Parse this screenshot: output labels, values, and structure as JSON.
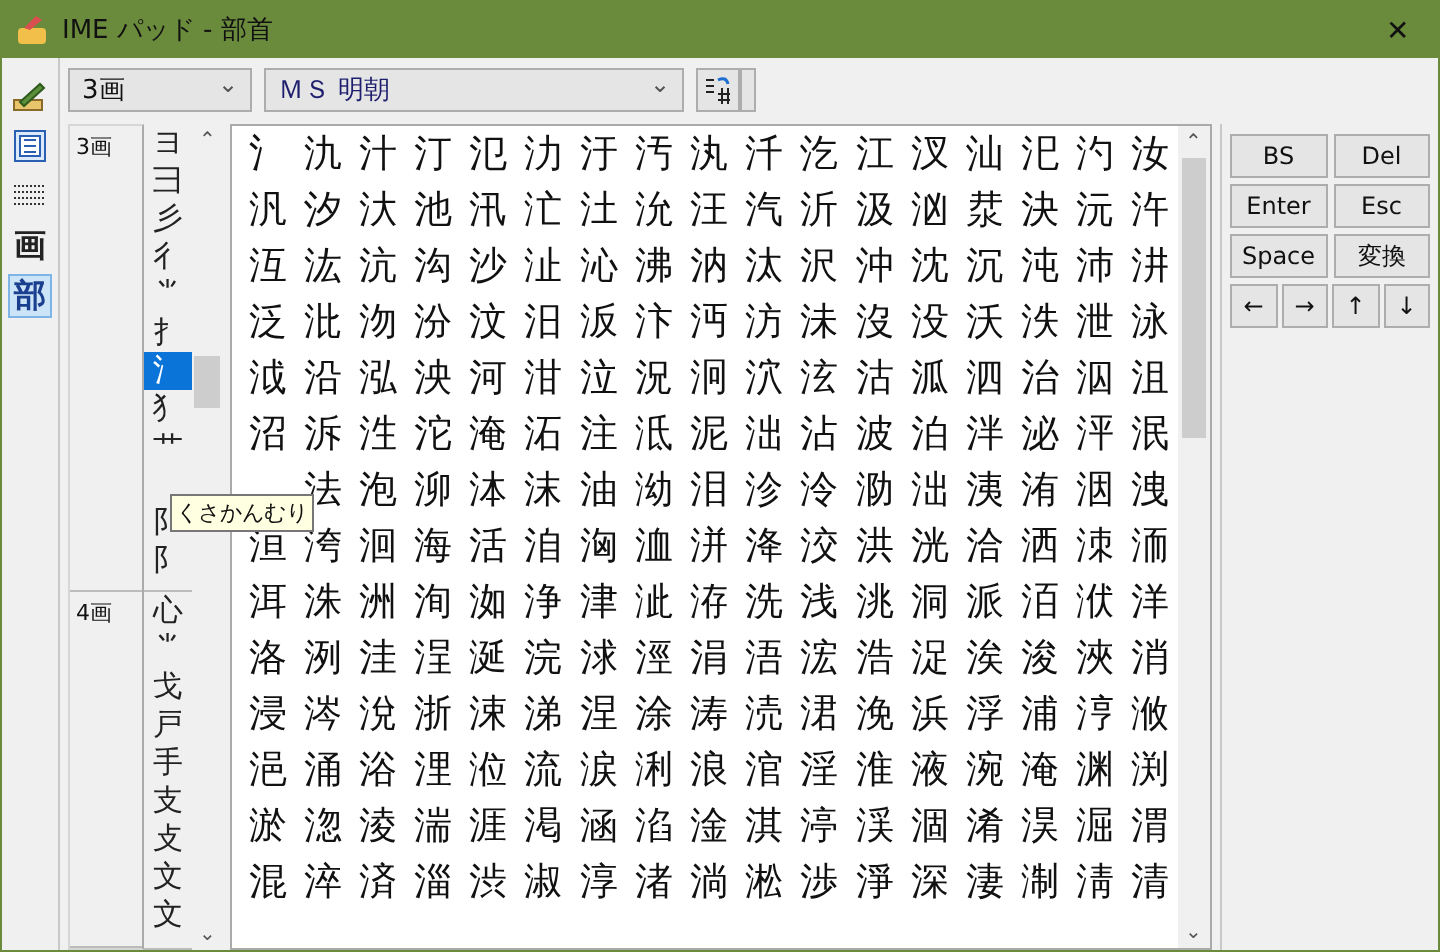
{
  "window": {
    "title": "IME パッド - 部首",
    "close": "✕"
  },
  "tools": [
    {
      "kind": "pen",
      "selected": false
    },
    {
      "kind": "grid",
      "selected": false
    },
    {
      "kind": "keys",
      "selected": false
    },
    {
      "kind": "text",
      "label": "画",
      "selected": false
    },
    {
      "kind": "text",
      "label": "部",
      "selected": true
    }
  ],
  "stroke_dropdown": {
    "value": "3画",
    "caret": "⌄"
  },
  "font_dropdown": {
    "value": "ＭＳ 明朝",
    "caret": "⌄"
  },
  "radical_groups": [
    {
      "label": "3画",
      "items": [
        {
          "char": "ヨ",
          "selected": false
        },
        {
          "char": "彐",
          "selected": false
        },
        {
          "char": "彡",
          "selected": false
        },
        {
          "char": "彳",
          "selected": false
        },
        {
          "char": "⺌",
          "selected": false
        },
        {
          "char": "扌",
          "selected": false
        },
        {
          "char": "氵",
          "selected": true
        },
        {
          "char": "犭",
          "selected": false
        },
        {
          "char": "艹",
          "selected": false
        },
        {
          "selected": false
        },
        {
          "char": "阝",
          "selected": false
        },
        {
          "char": "阝",
          "selected": false
        }
      ]
    },
    {
      "label": "4画",
      "items": [
        {
          "char": "心",
          "selected": false
        },
        {
          "char": "⺌",
          "selected": false
        },
        {
          "char": "戈",
          "selected": false
        },
        {
          "char": "戸",
          "selected": false
        },
        {
          "char": "手",
          "selected": false
        },
        {
          "char": "支",
          "selected": false
        },
        {
          "char": "攴",
          "selected": false
        },
        {
          "char": "文",
          "selected": false
        },
        {
          "char": "文",
          "selected": false
        }
      ]
    }
  ],
  "scroll_up": "⌃",
  "scroll_down": "⌄",
  "tooltip": "くさかんむり",
  "kanji_rows": [
    "氵氿汁汀氾氻汙汚汍汘汔江汊汕汜汋汝",
    "汎汐汏池汛汒汢沇汪汽沂汲汹汬決沅汻",
    "沍汯沆沟沙沚沁沸汭汰沢沖沈沉沌沛汫",
    "泛沘沕汾汶汨汳汴沔汸沬沒没沃泆泄泳",
    "泧沿泓泱河泔泣況泂泬泫沽泒泗治泅沮",
    "沼泝泩沱淹沰注泜泥泏沾波泊泮泌泙泯",
    "　法泡泖泍沫油泑泪沴泠泐泏洟洧洇洩",
    "洹洿洄海活洎洶洫洴洚洨洪洸洽洒洓洏",
    "洱洙洲洵洳浄津泚洊洗浅洮洞派洦洑洋",
    "洛洌洼浧涎浣浗涇涓浯浤浩浞涘浚浹消",
    "浸涔涗浙涑涕涅涂涛涜涒浼浜浮浦涥浟",
    "浥涌浴浬涖流涙浰浪涫淫淮液涴淹渊渕",
    "淤淴淩湍涯渇涵淊淦淇渟渓涸淆淏淈渭",
    "混淬済淄渋淑淳渚淌淞渉淨深淒淛淸清"
  ],
  "keys": [
    {
      "label": "BS"
    },
    {
      "label": "Del"
    },
    {
      "label": "Enter"
    },
    {
      "label": "Esc"
    },
    {
      "label": "Space"
    },
    {
      "label": "変換"
    },
    {
      "label": "←"
    },
    {
      "label": "→"
    },
    {
      "label": "↑"
    },
    {
      "label": "↓"
    }
  ]
}
